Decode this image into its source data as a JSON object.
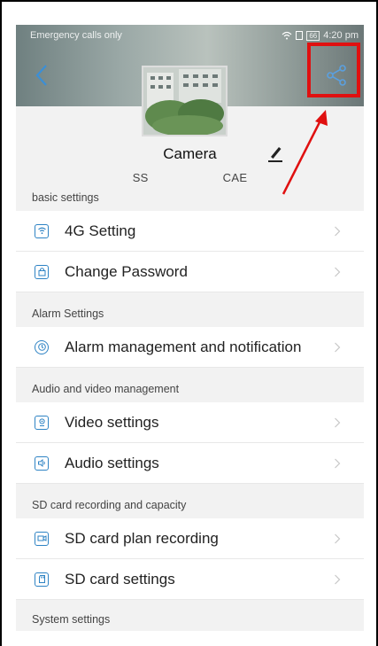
{
  "status_bar": {
    "left_text": "Emergency calls only",
    "battery": "66",
    "time": "4:20 pm"
  },
  "header": {
    "back_icon": "chevron-left-icon",
    "share_icon": "share-icon"
  },
  "device": {
    "name": "Camera",
    "id_prefix": "SS",
    "id_suffix": "CAE"
  },
  "sections": [
    {
      "title": "basic settings",
      "items": [
        {
          "label": "4G Setting",
          "icon": "signal-icon"
        },
        {
          "label": "Change Password",
          "icon": "lock-icon"
        }
      ]
    },
    {
      "title": "Alarm Settings",
      "items": [
        {
          "label": "Alarm management and notification",
          "icon": "alarm-icon"
        }
      ]
    },
    {
      "title": "Audio and video management",
      "items": [
        {
          "label": "Video settings",
          "icon": "webcam-icon"
        },
        {
          "label": "Audio settings",
          "icon": "speaker-icon"
        }
      ]
    },
    {
      "title": "SD card recording and capacity",
      "items": [
        {
          "label": "SD card plan recording",
          "icon": "video-record-icon"
        },
        {
          "label": "SD card settings",
          "icon": "sd-card-icon"
        }
      ]
    },
    {
      "title": "System settings",
      "items": []
    }
  ],
  "colors": {
    "accent": "#2e83c4",
    "highlight": "#e01010",
    "background": "#f2f2f2"
  }
}
